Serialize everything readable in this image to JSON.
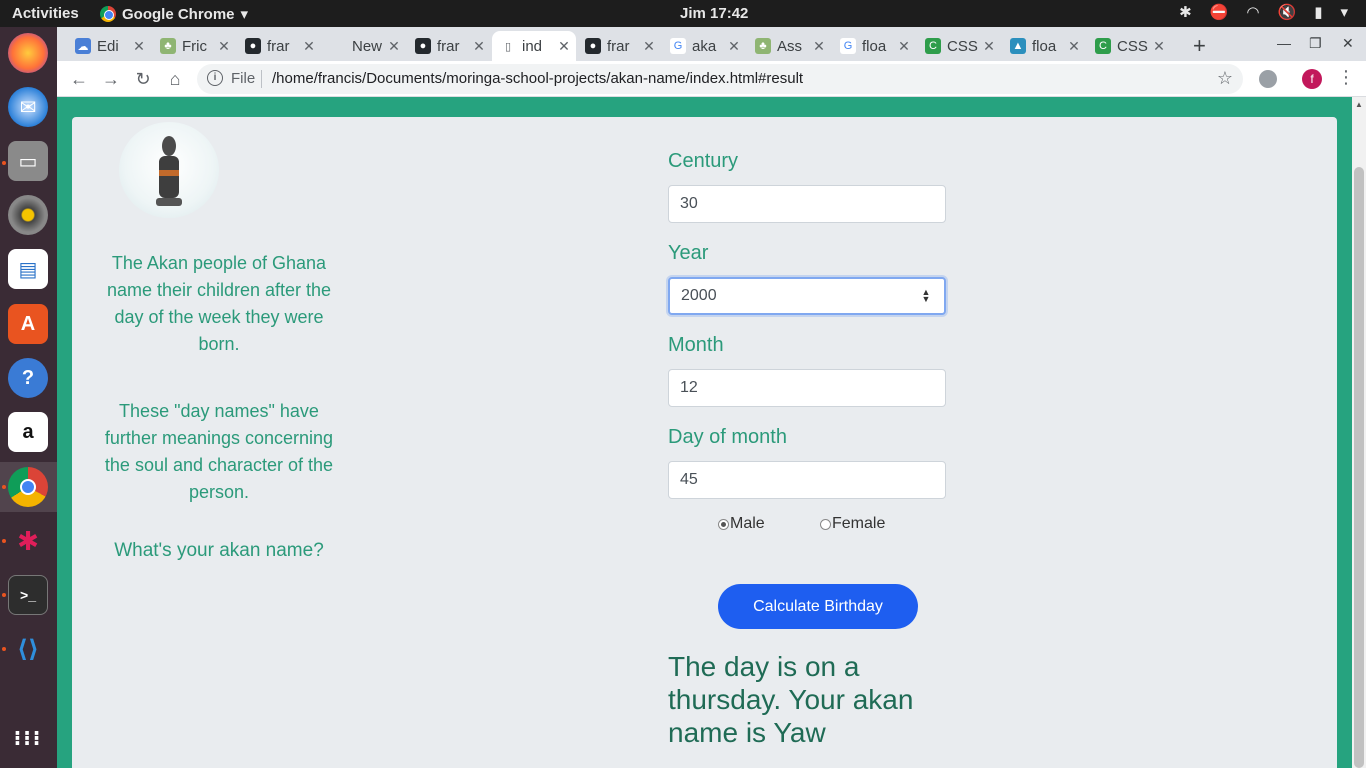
{
  "topbar": {
    "activities": "Activities",
    "app_name": "Google Chrome",
    "clock": "Jim 17:42"
  },
  "browser": {
    "tabs": [
      {
        "label": "Edi",
        "icon": "cloud-icon"
      },
      {
        "label": "Fric",
        "icon": "tree-icon"
      },
      {
        "label": "frar",
        "icon": "github-icon"
      },
      {
        "label": "New Ta",
        "icon": "none"
      },
      {
        "label": "frar",
        "icon": "github-icon"
      },
      {
        "label": "ind",
        "icon": "file-icon",
        "active": true
      },
      {
        "label": "frar",
        "icon": "github-icon"
      },
      {
        "label": "aka",
        "icon": "google-icon"
      },
      {
        "label": "Ass",
        "icon": "tree-icon"
      },
      {
        "label": "floa",
        "icon": "google-icon"
      },
      {
        "label": "CSS",
        "icon": "css-icon"
      },
      {
        "label": "floa",
        "icon": "bird-icon"
      },
      {
        "label": "CSS",
        "icon": "css-icon"
      }
    ],
    "omnibox": {
      "scheme": "File",
      "url": "/home/francis/Documents/moringa-school-projects/akan-name/index.html#result"
    },
    "profile_initial": "f"
  },
  "page": {
    "intro_1": "The Akan people of Ghana name their children after the day of the week they were born.",
    "intro_2": "These \"day names\" have further meanings concerning the soul and character of the person.",
    "question": "What's your akan name?",
    "form": {
      "century_label": "Century",
      "century_value": "30",
      "year_label": "Year",
      "year_value": "2000",
      "month_label": "Month",
      "month_value": "12",
      "day_label": "Day of month",
      "day_value": "45",
      "gender_male": "Male",
      "gender_female": "Female",
      "selected_gender": "Male",
      "submit_label": "Calculate Birthday"
    },
    "result": "The day is on a thursday. Your akan name is Yaw"
  },
  "colors": {
    "page_bg": "#26a37f",
    "text_accent": "#2b9a7a",
    "button": "#1e5ef0",
    "result_text": "#1f6b55"
  }
}
